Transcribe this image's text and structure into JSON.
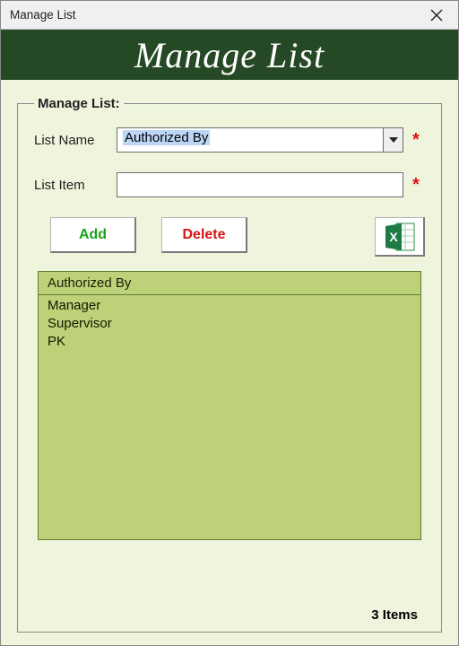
{
  "window": {
    "title": "Manage List"
  },
  "banner": {
    "title": "Manage List"
  },
  "group": {
    "legend": "Manage List:"
  },
  "form": {
    "listNameLabel": "List Name",
    "listNameValue": "Authorized By",
    "listItemLabel": "List Item",
    "listItemValue": "",
    "required": "*"
  },
  "buttons": {
    "add": "Add",
    "delete": "Delete",
    "excel": "Export to Excel"
  },
  "listbox": {
    "header": "Authorized By",
    "items": [
      "Manager",
      "Supervisor",
      "PK"
    ]
  },
  "countLabel": "3 Items"
}
